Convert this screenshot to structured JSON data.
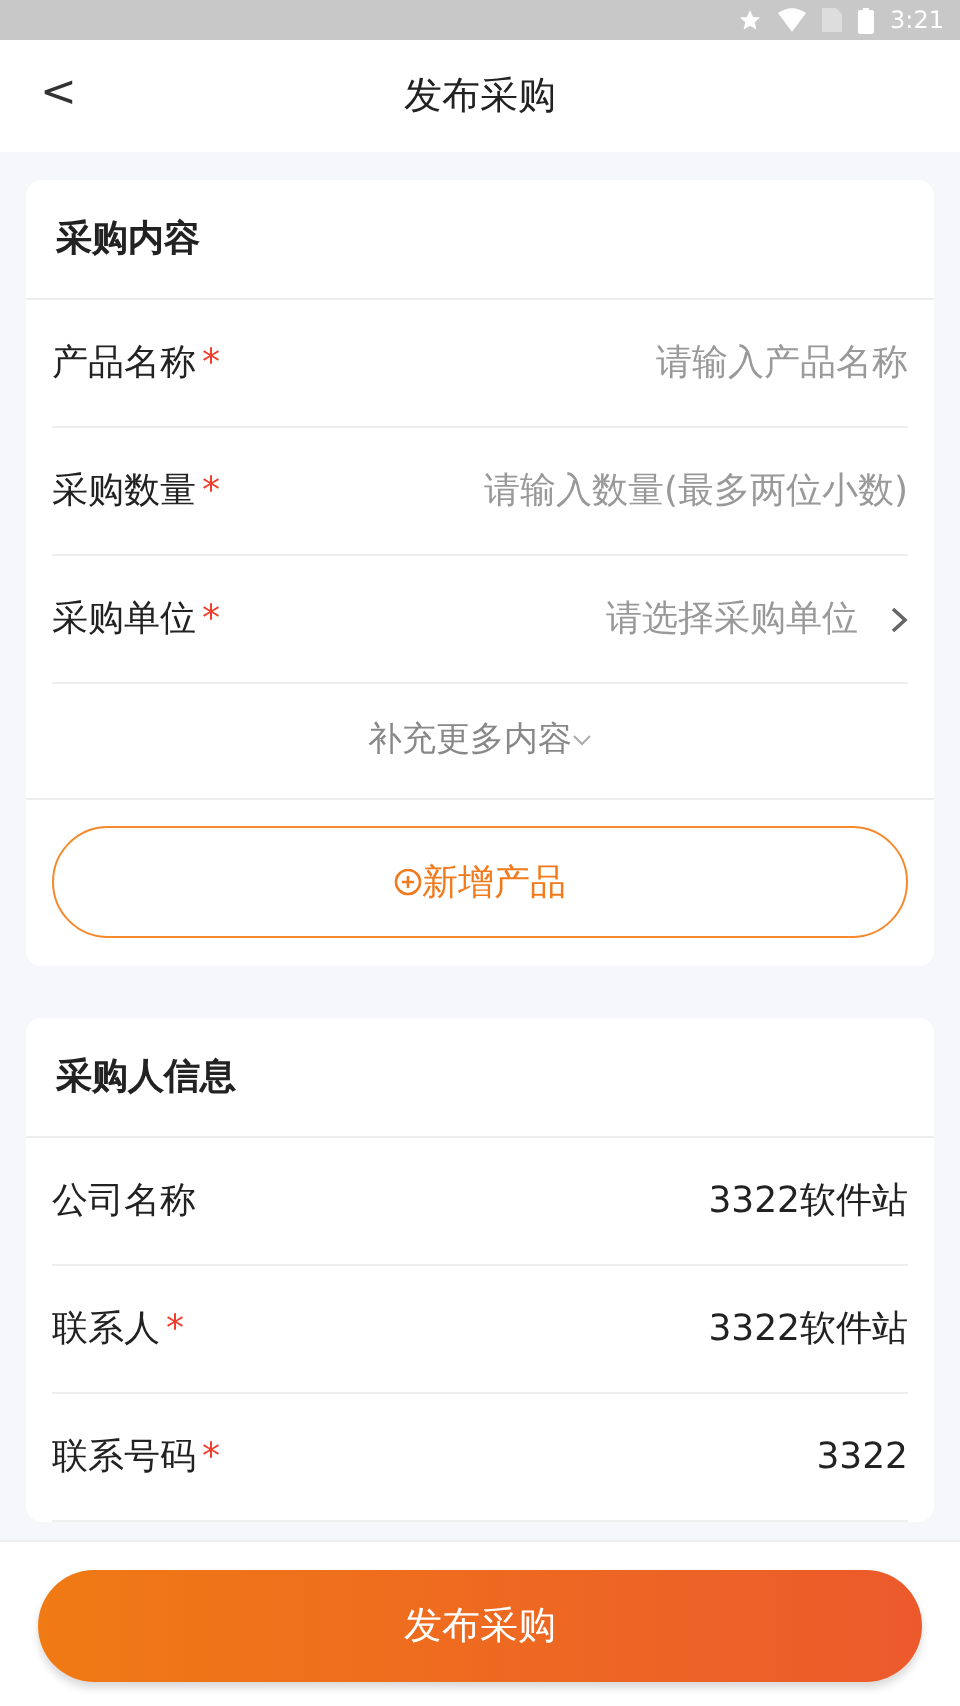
{
  "status_bar": {
    "time": "3:21"
  },
  "header": {
    "back": "<",
    "title": "发布采购"
  },
  "sections": [
    {
      "title": "采购内容",
      "rows": [
        {
          "kind": "input",
          "label": "产品名称",
          "mark": "*",
          "placeholder": "请输入产品名称"
        },
        {
          "kind": "input",
          "label": "采购数量",
          "mark": "*",
          "placeholder": "请输入数量(最多两位小数)"
        },
        {
          "kind": "select",
          "label": "采购单位",
          "mark": "*",
          "placeholder": "请选择采购单位"
        }
      ],
      "more": "补充更多内容",
      "add_button": "新增产品"
    },
    {
      "title": "采购人信息",
      "rows": [
        {
          "kind": "value",
          "label": "公司名称",
          "value": "3322软件站"
        },
        {
          "kind": "value",
          "label": "联系人",
          "mark": "*",
          "value": "3322软件站"
        },
        {
          "kind": "value",
          "label": "联系号码",
          "mark": "*",
          "value": "3322"
        }
      ]
    }
  ],
  "submit": "发布采购"
}
